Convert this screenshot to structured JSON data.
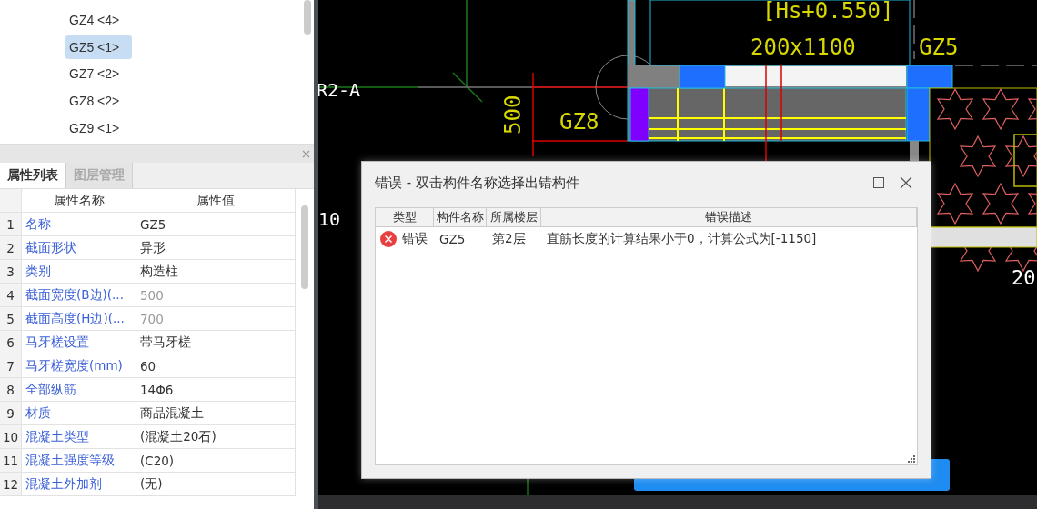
{
  "component_list": {
    "items": [
      {
        "label": "GZ4 <4>",
        "selected": false
      },
      {
        "label": "GZ5 <1>",
        "selected": true
      },
      {
        "label": "GZ7 <2>",
        "selected": false
      },
      {
        "label": "GZ8 <2>",
        "selected": false
      },
      {
        "label": "GZ9 <1>",
        "selected": false
      }
    ]
  },
  "properties": {
    "tabs": [
      {
        "label": "属性列表",
        "selected": true
      },
      {
        "label": "图层管理",
        "selected": false
      }
    ],
    "columns": [
      "属性名称",
      "属性值"
    ],
    "rows": [
      {
        "index": "1",
        "name": "名称",
        "value": "GZ5",
        "disabled": false
      },
      {
        "index": "2",
        "name": "截面形状",
        "value": "异形",
        "disabled": false
      },
      {
        "index": "3",
        "name": "类别",
        "value": "构造柱",
        "disabled": false
      },
      {
        "index": "4",
        "name": "截面宽度(B边)(...",
        "value": "500",
        "disabled": true
      },
      {
        "index": "5",
        "name": "截面高度(H边)(...",
        "value": "700",
        "disabled": true
      },
      {
        "index": "6",
        "name": "马牙槎设置",
        "value": "带马牙槎",
        "disabled": false
      },
      {
        "index": "7",
        "name": "马牙槎宽度(mm)",
        "value": "60",
        "disabled": false
      },
      {
        "index": "8",
        "name": "全部纵筋",
        "value": "14Φ6",
        "disabled": false
      },
      {
        "index": "9",
        "name": "材质",
        "value": "商品混凝土",
        "disabled": false
      },
      {
        "index": "10",
        "name": "混凝土类型",
        "value": "(混凝土20石)",
        "disabled": false
      },
      {
        "index": "11",
        "name": "混凝土强度等级",
        "value": "(C20)",
        "disabled": false
      },
      {
        "index": "12",
        "name": "混凝土外加剂",
        "value": "(无)",
        "disabled": false
      }
    ]
  },
  "canvas": {
    "labels": [
      "[Hs+0.550]",
      "200x1100",
      "GZ5",
      "R2-A",
      "500",
      "GZ8",
      "10",
      "20"
    ]
  },
  "error_dialog": {
    "title": "错误 - 双击构件名称选择出错构件",
    "columns": [
      "类型",
      "构件名称",
      "所属楼层",
      "错误描述"
    ],
    "rows": [
      {
        "type": "错误",
        "component": "GZ5",
        "floor": "第2层",
        "description": "直筋长度的计算结果小于0，计算公式为[-1150]"
      }
    ]
  }
}
